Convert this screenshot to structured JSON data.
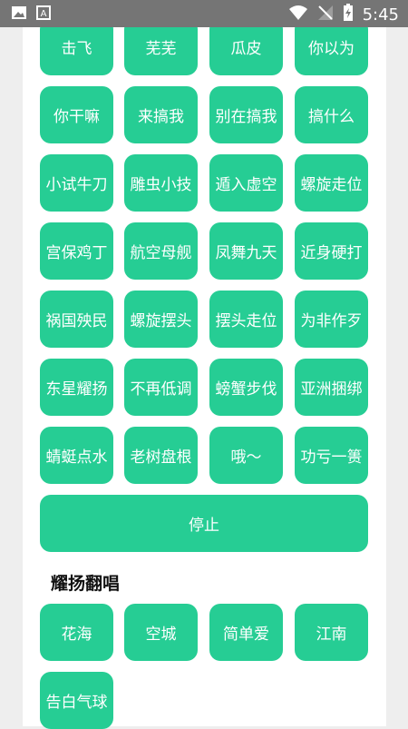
{
  "status_bar": {
    "time": "5:45",
    "icons": [
      "image-icon",
      "text-a-icon",
      "wifi-icon",
      "no-sim-icon",
      "battery-charging-icon"
    ]
  },
  "colors": {
    "button_bg": "#26cd94",
    "button_text": "#ffffff",
    "status_bar": "#757575"
  },
  "buttons": [
    "击飞",
    "芜芜",
    "瓜皮",
    "你以为",
    "你干嘛",
    "来搞我",
    "别在搞我",
    "搞什么",
    "小试牛刀",
    "雕虫小技",
    "遁入虚空",
    "螺旋走位",
    "宫保鸡丁",
    "航空母舰",
    "凤舞九天",
    "近身硬打",
    "祸国殃民",
    "螺旋摆头",
    "摆头走位",
    "为非作歹",
    "东星耀扬",
    "不再低调",
    "螃蟹步伐",
    "亚洲捆绑",
    "蜻蜓点水",
    "老树盘根",
    "哦～",
    "功亏一篑"
  ],
  "stop_label": "停止",
  "section2": {
    "title": "耀扬翻唱",
    "songs": [
      "花海",
      "空城",
      "简单爱",
      "江南",
      "告白气球"
    ]
  }
}
